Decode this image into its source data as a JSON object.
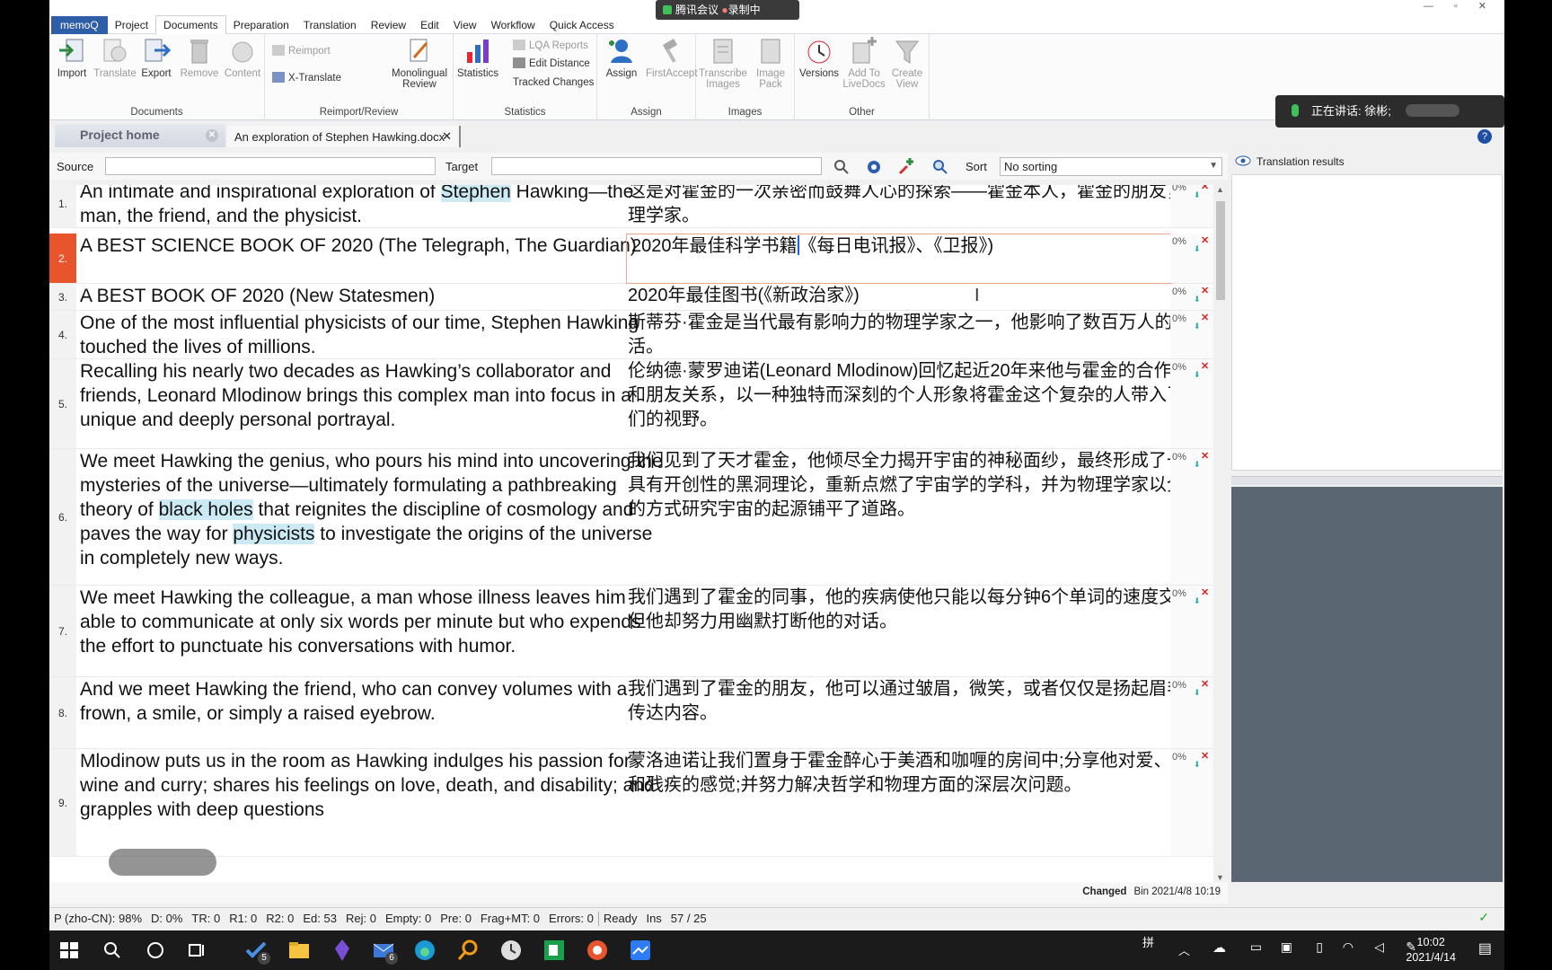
{
  "recording": {
    "left": "腾讯会议",
    "right": "录制中"
  },
  "menu": {
    "app": "memoQ",
    "items": [
      "Project",
      "Documents",
      "Preparation",
      "Translation",
      "Review",
      "Edit",
      "View",
      "Workflow",
      "Quick Access"
    ],
    "active_index": 1
  },
  "ribbon": {
    "documents": {
      "label": "Documents",
      "buttons": [
        "Import",
        "Translate",
        "Export",
        "Remove",
        "Content"
      ]
    },
    "reimport": {
      "label": "Reimport/Review",
      "reimport": "Reimport",
      "xtranslate": "X-Translate",
      "monolingual": "Monolingual Review"
    },
    "statistics": {
      "label": "Statistics",
      "statistics": "Statistics",
      "lqa": "LQA Reports",
      "edit_distance": "Edit Distance",
      "tracked": "Tracked Changes"
    },
    "assign": {
      "label": "Assign",
      "assign": "Assign",
      "firstaccept": "FirstAccept"
    },
    "images": {
      "label": "Images",
      "transcribe": "Transcribe Images",
      "image_pack": "Image Pack"
    },
    "other": {
      "label": "Other",
      "versions": "Versions",
      "add_livedocs": "Add To LiveDocs",
      "create_view": "Create View"
    }
  },
  "speaker": {
    "label": "正在讲话: 徐彬;"
  },
  "tabs": {
    "home": "Project home",
    "doc": "An exploration of Stephen Hawking.docx"
  },
  "filter": {
    "source_label": "Source",
    "target_label": "Target",
    "sort_label": "Sort",
    "sort_value": "No sorting"
  },
  "right_pane": {
    "title": "Translation results"
  },
  "segments": [
    {
      "n": "1.",
      "src": [
        "An intimate and inspirational exploration of ",
        {
          "hl": "Stephen"
        },
        " Hawking—the man, the friend, and the physicist."
      ],
      "tgt": "这是对霍金的一次亲密而鼓舞人心的探索——霍金本人，霍金的朋友，物理学家。",
      "pct": "0%"
    },
    {
      "n": "2.",
      "src": [
        "A BEST SCIENCE BOOK OF 2020 (The Telegraph, The Guardian)"
      ],
      "tgt_before": "2020年最佳科学书籍",
      "tgt_after": "《每日电讯报》、《卫报》)",
      "pct": "0%"
    },
    {
      "n": "3.",
      "src": [
        "A BEST BOOK OF 2020 (New Statesmen)"
      ],
      "tgt": "2020年最佳图书(《新政治家》)",
      "pct": "0%"
    },
    {
      "n": "4.",
      "src": [
        "One of the most influential physicists of our time, Stephen Hawking touched the lives of millions."
      ],
      "tgt": "斯蒂芬·霍金是当代最有影响力的物理学家之一，他影响了数百万人的生活。",
      "pct": "0%"
    },
    {
      "n": "5.",
      "src": [
        "Recalling his nearly two decades as Hawking’s collaborator and friends, Leonard Mlodinow brings this complex man into focus in a unique and deeply personal portrayal."
      ],
      "tgt": "伦纳德·蒙罗迪诺(Leonard Mlodinow)回忆起近20年来他与霍金的合作伙伴和朋友关系，以一种独特而深刻的个人形象将霍金这个复杂的人带入了人们的视野。",
      "pct": "0%"
    },
    {
      "n": "6.",
      "src": [
        "We meet Hawking the genius, who pours his mind into uncovering the mysteries of the universe—ultimately formulating a pathbreaking theory of ",
        {
          "hl": "black holes"
        },
        " that reignites the discipline of cosmology and paves the way for ",
        {
          "hl": "physicists"
        },
        " to investigate the origins of the universe in completely new ways."
      ],
      "tgt": "我们见到了天才霍金，他倾尽全力揭开宇宙的神秘面纱，最终形成了一个具有开创性的黑洞理论，重新点燃了宇宙学的学科，并为物理学家以全新的方式研究宇宙的起源铺平了道路。",
      "pct": "0%"
    },
    {
      "n": "7.",
      "src": [
        "We meet Hawking the colleague, a man whose illness leaves him able to communicate at only six words per minute but who expends the effort to punctuate his conversations with humor."
      ],
      "tgt": "我们遇到了霍金的同事，他的疾病使他只能以每分钟6个单词的速度交流，但他却努力用幽默打断他的对话。",
      "pct": "0%"
    },
    {
      "n": "8.",
      "src": [
        "And we meet Hawking the friend, who can convey volumes with a frown, a smile, or simply a raised eyebrow."
      ],
      "tgt": "我们遇到了霍金的朋友，他可以通过皱眉，微笑，或者仅仅是扬起眉毛来传达内容。",
      "pct": "0%"
    },
    {
      "n": "9.",
      "src": [
        "Mlodinow puts us in the room as Hawking indulges his passion for wine and curry; shares his feelings on love, death, and disability; and grapples with deep questions"
      ],
      "tgt": "蒙洛迪诺让我们置身于霍金醉心于美酒和咖喱的房间中;分享他对爱、死亡和残疾的感觉;并努力解决哲学和物理方面的深层次问题。",
      "pct": "0%"
    }
  ],
  "changed": {
    "label": "Changed",
    "info": "Bin 2021/4/8 10:19"
  },
  "status": [
    "P (zho-CN): 98%",
    "D: 0%",
    "TR: 0",
    "R1: 0",
    "R2: 0",
    "Ed: 53",
    "Rej: 0",
    "Empty: 0",
    "Pre: 0",
    "Frag+MT: 0",
    "Errors: 0",
    "Ready",
    "Ins",
    "57 / 25"
  ],
  "taskbar": {
    "time": "10:02",
    "date": "2021/4/14",
    "badge_todo": "5",
    "badge_mail": "6"
  },
  "colors": {
    "active_segment": "#e8552c",
    "highlight": "#cbeaf4",
    "app_blue": "#2f5ea8"
  }
}
